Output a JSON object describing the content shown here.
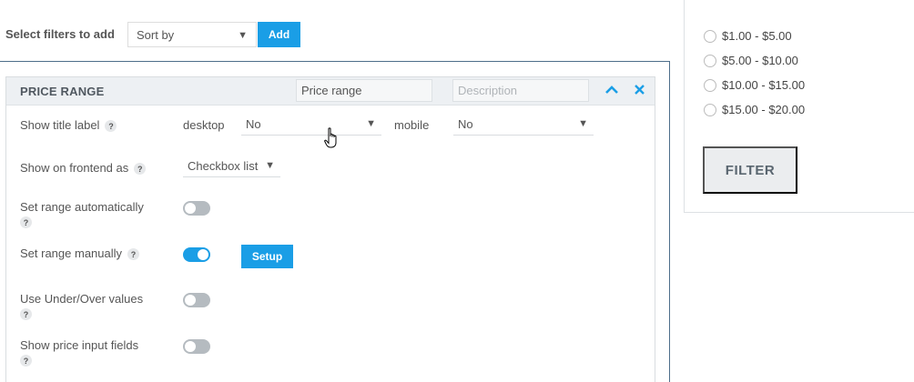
{
  "filter_bar": {
    "label": "Select filters to add",
    "sort_select_value": "Sort by",
    "add_label": "Add"
  },
  "price_range": {
    "title": "PRICE RANGE",
    "title_input_value": "Price range",
    "description_placeholder": "Description",
    "rows": {
      "show_title_label": {
        "label": "Show title label",
        "desktop_text": "desktop",
        "desktop_value": "No",
        "mobile_text": "mobile",
        "mobile_value": "No"
      },
      "show_frontend": {
        "label": "Show on frontend as",
        "value": "Checkbox list"
      },
      "set_range_auto": {
        "label": "Set range automatically",
        "enabled": false
      },
      "set_range_manual": {
        "label": "Set range manually",
        "enabled": true,
        "setup_label": "Setup"
      },
      "under_over": {
        "label": "Use Under/Over values",
        "enabled": false
      },
      "price_inputs": {
        "label": "Show price input fields",
        "enabled": false
      }
    },
    "help_glyph": "?"
  },
  "preview": {
    "options": [
      "$1.00 - $5.00",
      "$5.00 - $10.00",
      "$10.00 - $15.00",
      "$15.00 - $20.00"
    ],
    "filter_label": "FILTER"
  },
  "icons": {
    "collapse": "chevron-up-icon",
    "close": "close-icon",
    "help": "help-icon",
    "caret": "caret-down-icon",
    "cursor": "hand-cursor-icon"
  },
  "colors": {
    "accent": "#1a9ee6",
    "panel_header": "#edf0f3",
    "toggle_off": "#b5bbc0",
    "filter_button": "#ebedef"
  }
}
